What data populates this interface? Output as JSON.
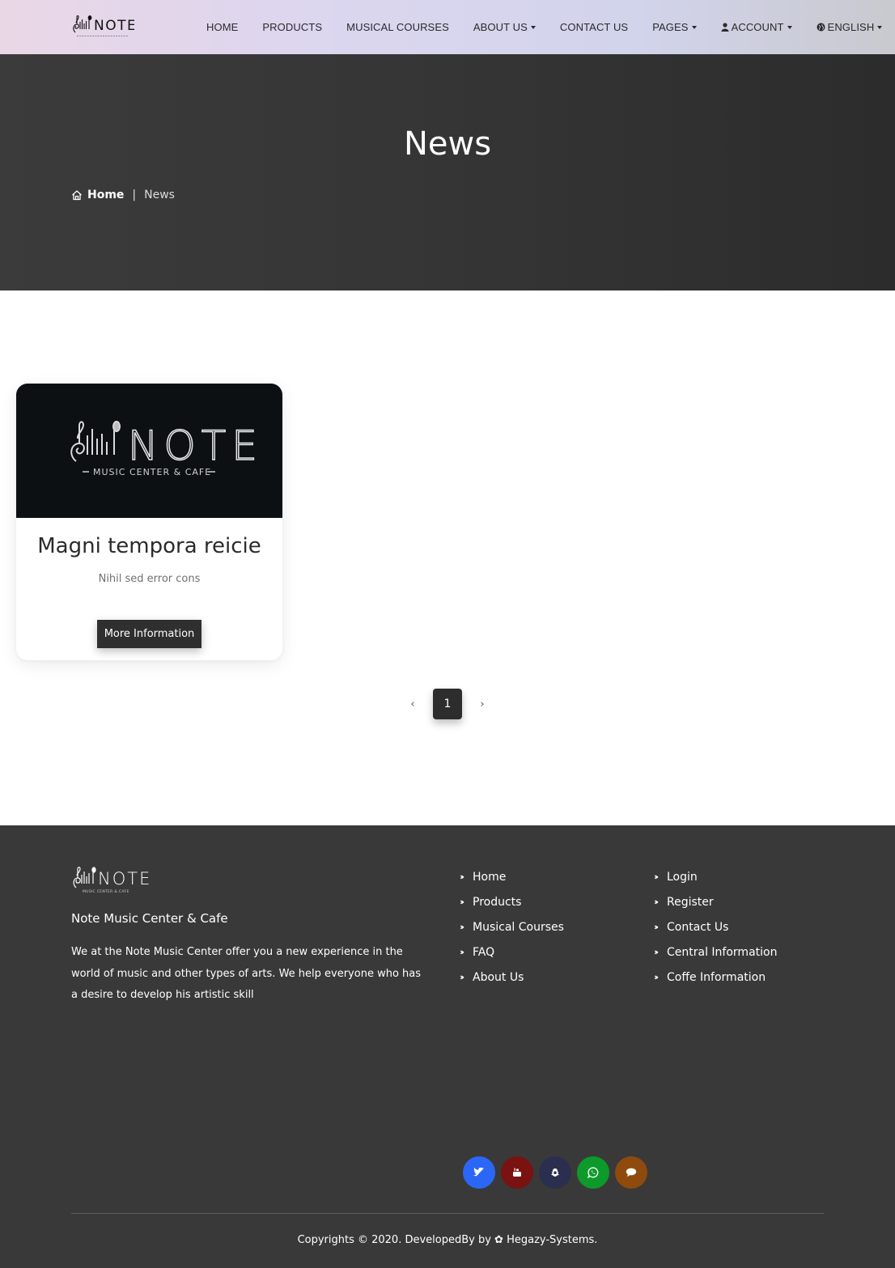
{
  "brand": {
    "logo_text": "NOTE",
    "logo_tagline": "MUSIC CENTER & CAFE"
  },
  "nav": {
    "items": [
      {
        "label": "HOME",
        "dropdown": false
      },
      {
        "label": "PRODUCTS",
        "dropdown": false
      },
      {
        "label": "MUSICAL COURSES",
        "dropdown": false
      },
      {
        "label": "ABOUT US",
        "dropdown": true
      },
      {
        "label": "CONTACT US",
        "dropdown": false
      },
      {
        "label": "PAGES",
        "dropdown": true
      },
      {
        "label": "ACCOUNT",
        "dropdown": true,
        "icon": "user-icon"
      },
      {
        "label": "ENGLISH",
        "dropdown": true,
        "icon": "globe-icon"
      }
    ]
  },
  "hero": {
    "title": "News",
    "breadcrumb": {
      "home": "Home",
      "current": "News"
    }
  },
  "news": [
    {
      "title": "Magni tempora reicie",
      "subtitle": "Nihil sed error cons",
      "button": "More Information"
    }
  ],
  "pagination": {
    "prev": "‹",
    "current": "1",
    "next": "›"
  },
  "footer": {
    "brand": "Note Music Center & Cafe",
    "description": "We at the Note Music Center offer you a new experience in the world of music and other types of arts. We help everyone who has a desire to develop his artistic skill",
    "links_col1": [
      "Home",
      "Products",
      "Musical Courses",
      "FAQ",
      "About Us"
    ],
    "links_col2": [
      "Login",
      "Register",
      "Contact Us",
      "Central Information",
      "Coffe Information"
    ],
    "social": [
      {
        "name": "twitter-icon",
        "color": "#2b67f6"
      },
      {
        "name": "youtube-icon",
        "color": "#7a1212"
      },
      {
        "name": "snapchat-icon",
        "color": "#2a2f4f"
      },
      {
        "name": "whatsapp-icon",
        "color": "#0d9a2a"
      },
      {
        "name": "chat-icon",
        "color": "#8e4b0d"
      }
    ],
    "copyright": "Copyrights © 2020. DevelopedBy by ✿ Hegazy-Systems."
  },
  "colors": {
    "hero_bg": "#353535",
    "footer_bg": "#393939",
    "button_bg": "#2f2f2f"
  }
}
